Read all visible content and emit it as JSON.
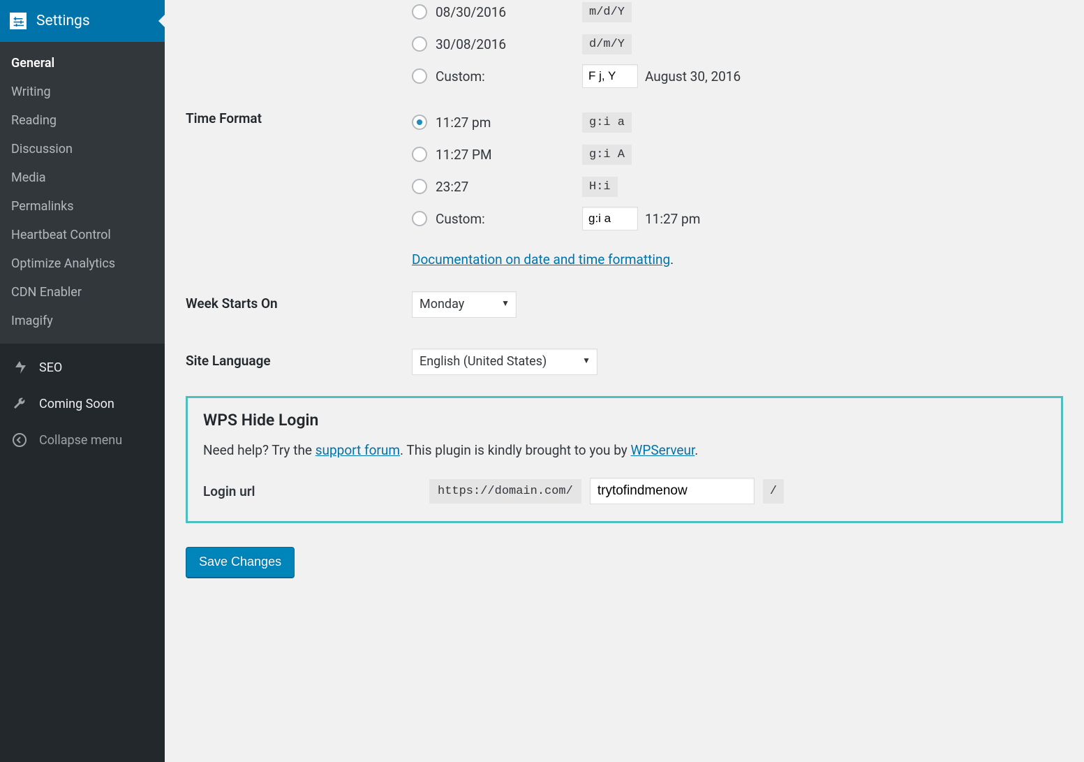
{
  "sidebar": {
    "header": "Settings",
    "submenu": [
      {
        "label": "General",
        "active": true
      },
      {
        "label": "Writing"
      },
      {
        "label": "Reading"
      },
      {
        "label": "Discussion"
      },
      {
        "label": "Media"
      },
      {
        "label": "Permalinks"
      },
      {
        "label": "Heartbeat Control"
      },
      {
        "label": "Optimize Analytics"
      },
      {
        "label": "CDN Enabler"
      },
      {
        "label": "Imagify"
      }
    ],
    "lower": [
      {
        "label": "SEO",
        "icon": "seo"
      },
      {
        "label": "Coming Soon",
        "icon": "wrench"
      },
      {
        "label": "Collapse menu",
        "icon": "collapse",
        "class": "collapse"
      }
    ]
  },
  "date_format": {
    "options": [
      {
        "label": "08/30/2016",
        "code": "m/d/Y"
      },
      {
        "label": "30/08/2016",
        "code": "d/m/Y"
      }
    ],
    "custom_label": "Custom:",
    "custom_value": "F j, Y",
    "custom_preview": "August 30, 2016"
  },
  "time_format": {
    "title": "Time Format",
    "options": [
      {
        "label": "11:27 pm",
        "code": "g:i a",
        "checked": true
      },
      {
        "label": "11:27 PM",
        "code": "g:i A"
      },
      {
        "label": "23:27",
        "code": "H:i"
      }
    ],
    "custom_label": "Custom:",
    "custom_value": "g:i a",
    "custom_preview": "11:27 pm",
    "doc_link_text": "Documentation on date and time formatting",
    "doc_link_period": "."
  },
  "week_starts": {
    "title": "Week Starts On",
    "value": "Monday"
  },
  "site_language": {
    "title": "Site Language",
    "value": "English (United States)"
  },
  "wps": {
    "title": "WPS Hide Login",
    "help_before": "Need help? Try the ",
    "help_link": "support forum",
    "help_mid": ". This plugin is kindly brought to you by ",
    "help_link2": "WPServeur",
    "help_after": ".",
    "login_label": "Login url",
    "url_prefix": "https://domain.com/",
    "url_value": "trytofindmenow",
    "url_suffix": "/"
  },
  "save_button": "Save Changes"
}
